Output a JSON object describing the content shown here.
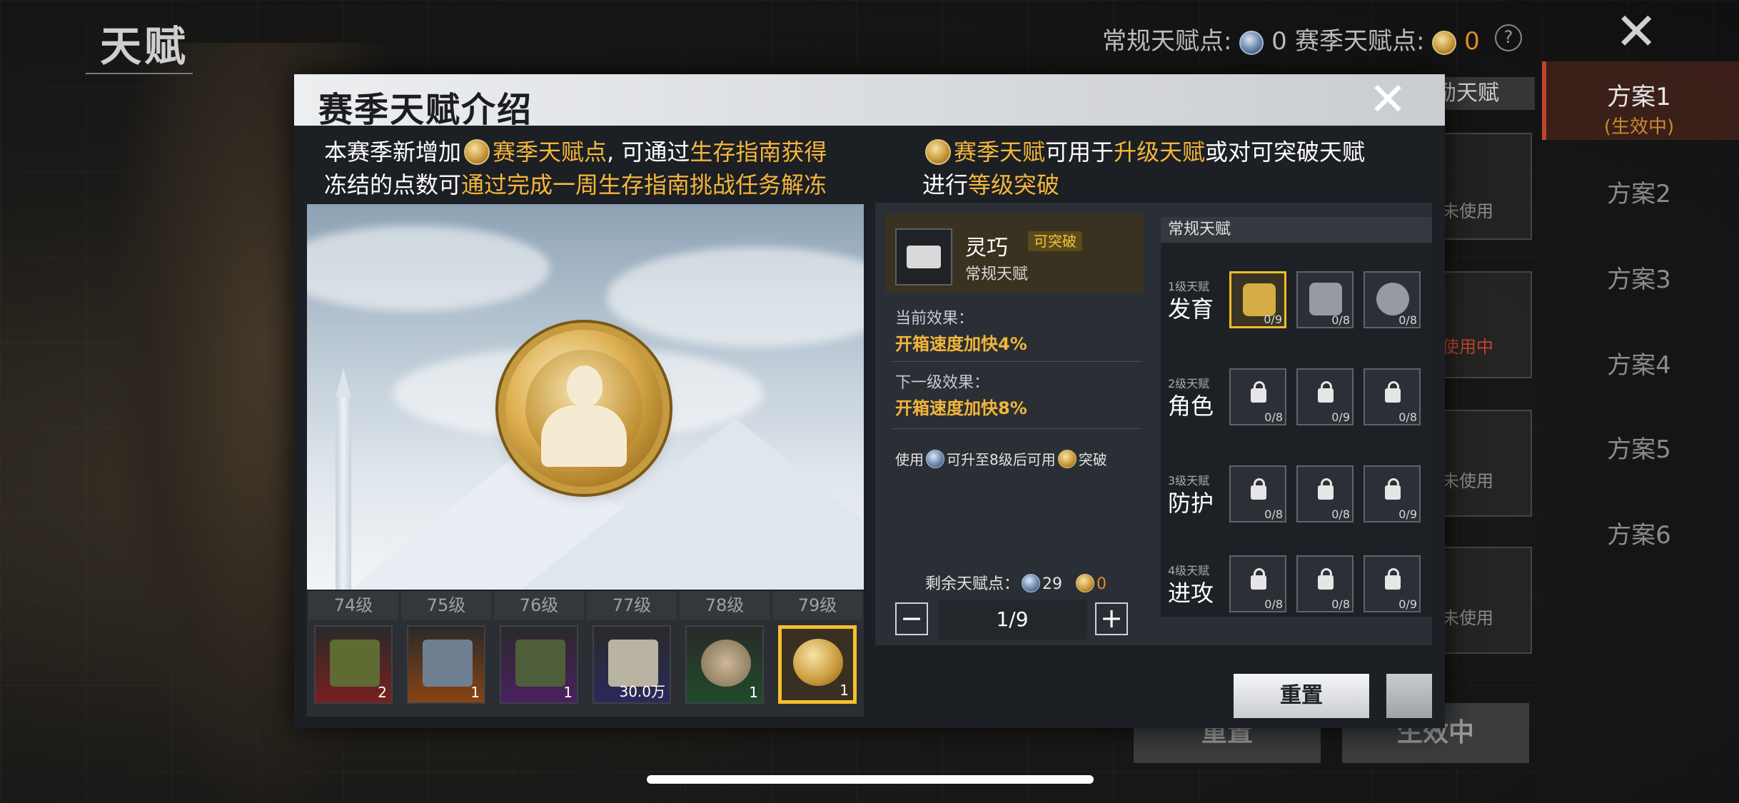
{
  "background": {
    "title": "天赋",
    "normal_points_label": "常规天赋点:",
    "normal_points_value": "0",
    "season_points_label": "赛季天赋点:",
    "season_points_value": "0",
    "help_icon": "?",
    "close_icon": "✕",
    "reward_tab": "励天赋",
    "plans": [
      "方案1",
      "方案2",
      "方案3",
      "方案4",
      "方案5",
      "方案6"
    ],
    "plan_active_sub": "(生效中)",
    "slot_labels": [
      "未使用",
      "使用中",
      "未使用",
      "未使用"
    ],
    "reset_label": "重置",
    "apply_label": "生效中"
  },
  "modal": {
    "title": "赛季天赋介绍",
    "close_icon": "✕",
    "left_desc": {
      "line1_a": "本赛季新增加",
      "line1_b": "赛季天赋点",
      "line1_c": ", 可通过",
      "line1_d": "生存指南获得",
      "line2_a": "冻结的点数可",
      "line2_b": "通过完成一周生存指南挑战任务解冻"
    },
    "right_desc": {
      "line1_b": "赛季天赋",
      "line1_c": "可用于",
      "line1_d": "升级天赋",
      "line1_e": "或对可突破天赋",
      "line2_a": "进行",
      "line2_b": "等级突破"
    },
    "levels": [
      {
        "label": "74级",
        "qty": "2",
        "color": "#7a1f1f"
      },
      {
        "label": "75级",
        "qty": "1",
        "color": "#8a4413"
      },
      {
        "label": "76级",
        "qty": "1",
        "color": "#4a2060"
      },
      {
        "label": "77级",
        "qty": "30.0万",
        "color": "#2a2a5a"
      },
      {
        "label": "78级",
        "qty": "1",
        "color": "#1f4a2a"
      },
      {
        "label": "79级",
        "qty": "1",
        "color": "#3a3022"
      }
    ],
    "talent": {
      "name": "灵巧",
      "badge": "可突破",
      "type": "常规天赋",
      "current_label": "当前效果：",
      "current_value": "开箱速度加快4%",
      "next_label": "下一级效果：",
      "next_value": "开箱速度加快8%",
      "use_note_a": "使用",
      "use_note_b": "可升至8级后可用",
      "use_note_c": "突破",
      "remain_label": "剩余天赋点：",
      "remain_normal": "29",
      "remain_season": "0",
      "minus": "−",
      "plus": "+",
      "stepper_value": "1/9"
    },
    "tree": {
      "header": "常规天赋",
      "tiers": [
        {
          "small": "1级天赋",
          "big": "发育",
          "nodes": [
            "0/9",
            "0/8",
            "0/8"
          ]
        },
        {
          "small": "2级天赋",
          "big": "角色",
          "nodes": [
            "0/8",
            "0/9",
            "0/8"
          ]
        },
        {
          "small": "3级天赋",
          "big": "防护",
          "nodes": [
            "0/8",
            "0/8",
            "0/9"
          ]
        },
        {
          "small": "4级天赋",
          "big": "进攻",
          "nodes": [
            "0/8",
            "0/8",
            "0/9"
          ]
        }
      ]
    },
    "reset_button": "重置"
  }
}
